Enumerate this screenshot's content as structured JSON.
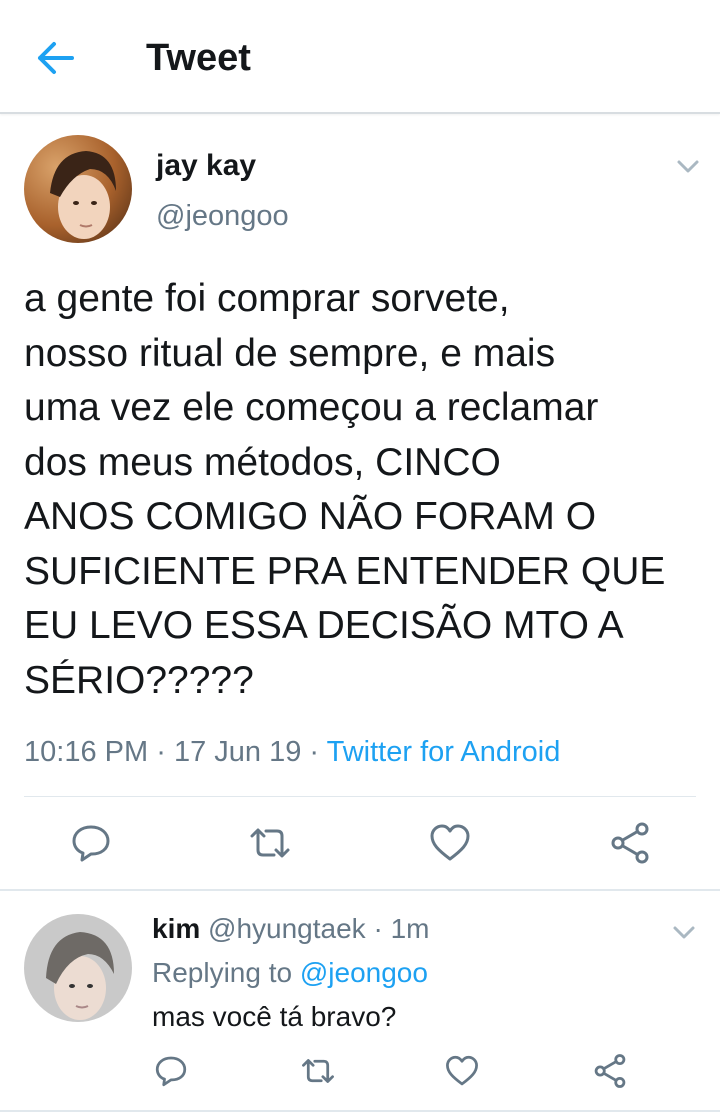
{
  "header": {
    "title": "Tweet"
  },
  "tweet": {
    "author_name": "jay kay",
    "author_handle": "@jeongoo",
    "text": "a gente foi comprar sorvete,\nnosso ritual de sempre, e mais\numa vez ele começou a reclamar\ndos meus métodos, CINCO\nANOS COMIGO NÃO FORAM O\nSUFICIENTE PRA ENTENDER QUE\nEU LEVO ESSA DECISÃO MTO A\nSÉRIO?????",
    "time": "10:16 PM",
    "date": "17 Jun 19",
    "sep": "·",
    "source": "Twitter for Android"
  },
  "reply": {
    "author_name": "kim",
    "author_handle": "@hyungtaek",
    "time_ago": "1m",
    "sep": "·",
    "replying_label": "Replying to",
    "replying_to": "@jeongoo",
    "text": "mas você tá bravo?"
  },
  "colors": {
    "accent": "#1da1f2",
    "text": "#14171a",
    "muted": "#657786",
    "icon": "#657786",
    "divider": "#e1e8ed"
  },
  "icons": [
    "back-arrow-icon",
    "chevron-down-icon",
    "reply-icon",
    "retweet-icon",
    "like-icon",
    "share-icon"
  ]
}
